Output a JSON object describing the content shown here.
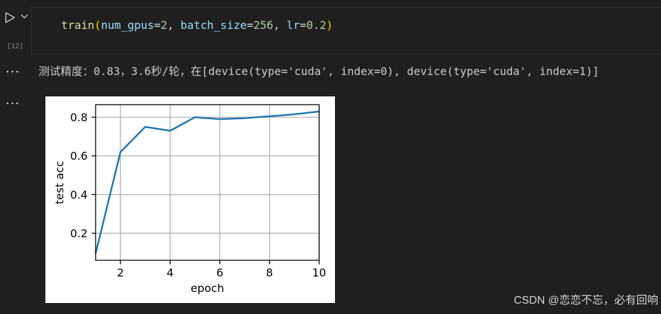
{
  "theme": {
    "background": "#1f1f1f",
    "foreground": "#cccccc",
    "syntax": {
      "function": "#dcdcaa",
      "bracket": "#ffd700",
      "variable": "#9cdcfe",
      "number": "#b5cea8",
      "punctuation": "#d4d4d4"
    }
  },
  "icons": {
    "run_button": "play-icon",
    "run_options": "chevron-down-icon",
    "output_actions": "ellipsis-icon"
  },
  "cell": {
    "execution_count": "[12]",
    "code": [
      "train",
      "(",
      "num_gpus",
      "=",
      "2",
      ", ",
      "batch_size",
      "=",
      "256",
      ", ",
      "lr",
      "=",
      "0.2",
      ")"
    ]
  },
  "outputs": {
    "stream_text": "测试精度：0.83，3.6秒/轮，在[device(type='cuda', index=0), device(type='cuda', index=1)]"
  },
  "chart_data": {
    "type": "line",
    "x": [
      1,
      2,
      3,
      4,
      5,
      6,
      7,
      8,
      9,
      10
    ],
    "series": [
      {
        "values": [
          0.095,
          0.62,
          0.75,
          0.73,
          0.8,
          0.79,
          0.795,
          0.805,
          0.815,
          0.83
        ],
        "color": "#1f77b4"
      }
    ],
    "xlabel": "epoch",
    "ylabel": "test acc",
    "xlim": [
      1,
      10
    ],
    "ylim": [
      0.06,
      0.865
    ],
    "xticks": [
      2,
      4,
      6,
      8,
      10
    ],
    "xtick_labels": [
      "2",
      "4",
      "6",
      "8",
      "10"
    ],
    "yticks": [
      0.2,
      0.4,
      0.6,
      0.8
    ],
    "ytick_labels": [
      "0.2",
      "0.4",
      "0.6",
      "0.8"
    ],
    "grid": true
  },
  "watermark": "CSDN @恋恋不忘，必有回响"
}
